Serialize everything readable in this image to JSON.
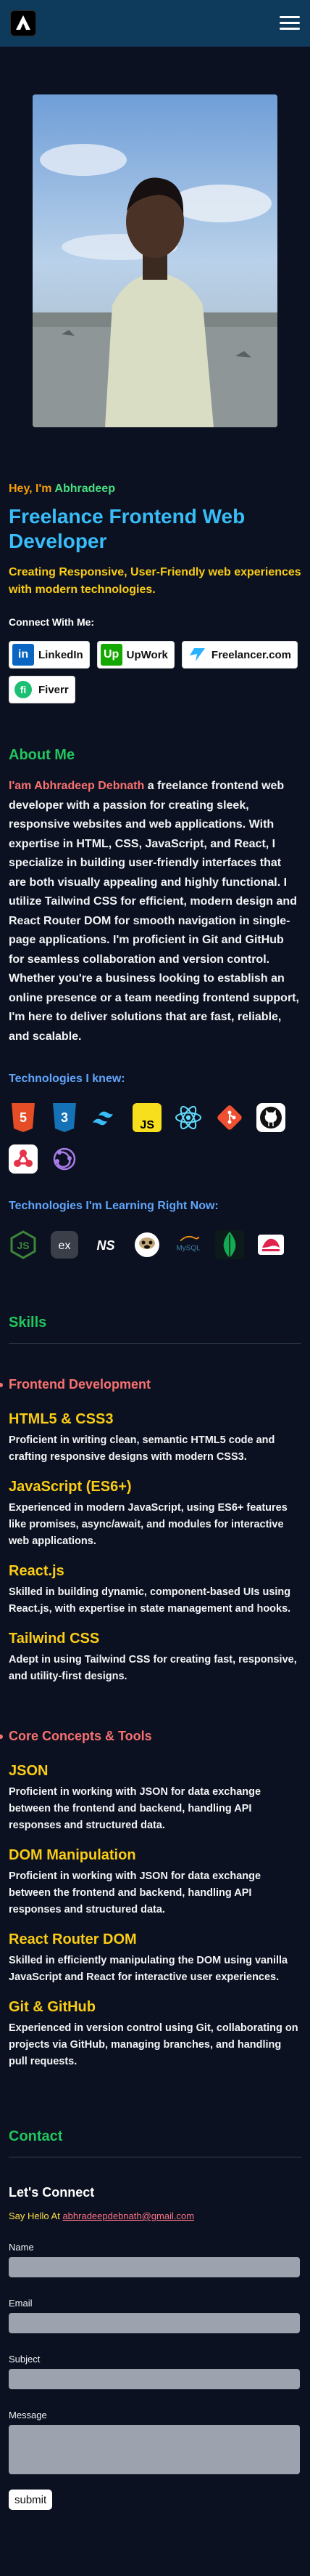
{
  "header": {
    "logo_alt": "AD logo",
    "menu_icon": "hamburger-icon"
  },
  "hero": {
    "greeting_prefix": "Hey, I'm",
    "name": "Abhradeep",
    "role": "Freelance Frontend Web Developer",
    "tagline": "Creating Responsive, User-Friendly web experiences with modern technologies.",
    "connect_label": "Connect With Me:",
    "buttons": [
      {
        "label": "LinkedIn",
        "icon": "linkedin-icon",
        "color": "#0a66c2"
      },
      {
        "label": "UpWork",
        "icon": "upwork-icon",
        "color": "#14a800"
      },
      {
        "label": "Freelancer.com",
        "icon": "freelancer-icon",
        "color": "#29b2fe"
      },
      {
        "label": "Fiverr",
        "icon": "fiverr-icon",
        "color": "#1dbf73"
      }
    ]
  },
  "about": {
    "heading": "About Me",
    "intro_highlight": "I'am Abhradeep Debnath",
    "body": " a freelance frontend web developer with a passion for creating sleek, responsive websites and web applications. With expertise in HTML, CSS, JavaScript, and React, I specialize in building user-friendly interfaces that are both visually appealing and highly functional. I utilize Tailwind CSS for efficient, modern design and React Router DOM for smooth navigation in single-page applications. I'm proficient in Git and GitHub for seamless collaboration and version control. Whether you're a business looking to establish an online presence or a team needing frontend support, I'm here to deliver solutions that are fast, reliable, and scalable.",
    "tech_known_heading": "Technologies I knew:",
    "tech_known": [
      "html5-icon",
      "css3-icon",
      "tailwind-icon",
      "javascript-icon",
      "react-icon",
      "git-icon",
      "github-icon",
      "redux-icon",
      "redux-toolkit-icon"
    ],
    "tech_learning_heading": "Technologies I'm Learning Right Now:",
    "tech_learning": [
      "nodejs-icon",
      "express-icon",
      "nextjs-icon",
      "postman-icon",
      "mysql-icon",
      "mongodb-icon",
      "nestjs-icon"
    ],
    "mysql_label": "MySQL"
  },
  "skills": {
    "heading": "Skills",
    "categories": [
      {
        "title": "Frontend Development",
        "items": [
          {
            "name": "HTML5 & CSS3",
            "desc": "Proficient in writing clean, semantic HTML5 code and crafting responsive designs with modern CSS3."
          },
          {
            "name": "JavaScript (ES6+)",
            "desc": "Experienced in modern JavaScript, using ES6+ features like promises, async/await, and modules for interactive web applications."
          },
          {
            "name": "React.js",
            "desc": "Skilled in building dynamic, component-based UIs using React.js, with expertise in state management and hooks."
          },
          {
            "name": "Tailwind CSS",
            "desc": "Adept in using Tailwind CSS for creating fast, responsive, and utility-first designs."
          }
        ]
      },
      {
        "title": "Core Concepts & Tools",
        "items": [
          {
            "name": "JSON",
            "desc": "Proficient in working with JSON for data exchange between the frontend and backend, handling API responses and structured data."
          },
          {
            "name": "DOM Manipulation",
            "desc": "Proficient in working with JSON for data exchange between the frontend and backend, handling API responses and structured data."
          },
          {
            "name": "React Router DOM",
            "desc": "Skilled in efficiently manipulating the DOM using vanilla JavaScript and React for interactive user experiences."
          },
          {
            "name": "Git & GitHub",
            "desc": "Experienced in version control using Git, collaborating on projects via GitHub, managing branches, and handling pull requests."
          }
        ]
      }
    ]
  },
  "contact": {
    "heading": "Contact",
    "connect_heading": "Let's Connect",
    "say_hello": "Say Hello At",
    "email": "abhradeepdebnath@gmail.com",
    "fields": {
      "name": "Name",
      "email": "Email",
      "subject": "Subject",
      "message": "Message"
    },
    "submit": "submit"
  }
}
